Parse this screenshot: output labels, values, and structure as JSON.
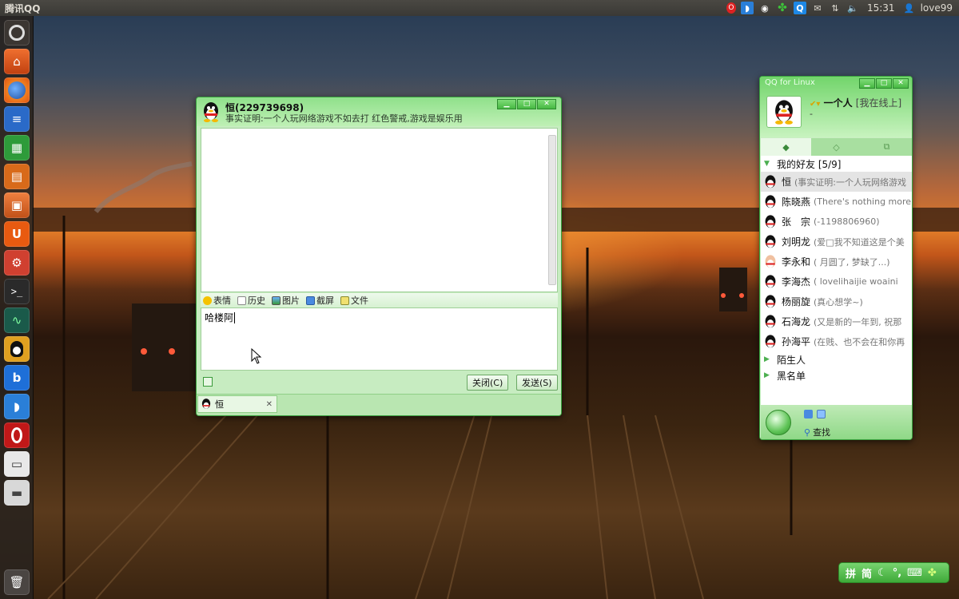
{
  "top_panel": {
    "app_title": "腾讯QQ",
    "clock": "15:31",
    "user": "love99",
    "tray_icons": [
      "opera-icon",
      "rss-icon",
      "qq-icon",
      "clover-icon",
      "qq-browser-icon",
      "mail-icon",
      "network-icon",
      "volume-icon",
      "user-icon"
    ]
  },
  "launcher": {
    "items": [
      "dash-home",
      "home-folder",
      "firefox",
      "writer",
      "calc",
      "impress",
      "software-center",
      "ubuntu-one",
      "system-settings",
      "terminal",
      "system-monitor",
      "qq",
      "baidu",
      "rss-reader",
      "opera",
      "window-app",
      "disk-drive",
      "trash"
    ]
  },
  "chat_window": {
    "contact_name": "恒(229739698)",
    "signature": "事实证明:一个人玩网络游戏不如去打 红色警戒,游戏是娱乐用",
    "toolbar": {
      "emoticon": "表情",
      "history": "历史",
      "image": "图片",
      "screenshot": "截屏",
      "file": "文件"
    },
    "input_text": "哈楼阿",
    "close_button": "关闭(C)",
    "send_button": "发送(S)",
    "tab_label": "恒"
  },
  "qq_panel": {
    "title": "QQ for Linux",
    "self_name": "一个人",
    "self_status": "[我在线上]",
    "self_sub": "-",
    "groups": {
      "friends_label": "我的好友 [5/9]",
      "strangers_label": "陌生人",
      "blacklist_label": "黑名单"
    },
    "friends": [
      {
        "name": "恒",
        "signature": "(事实证明:一个人玩网络游戏",
        "selected": true
      },
      {
        "name": "陈晓燕",
        "signature": "(There's nothing more"
      },
      {
        "name": "张　宗",
        "signature": "(-1198806960)"
      },
      {
        "name": "刘明龙",
        "signature": "(爱□我不知道这是个美"
      },
      {
        "name": "李永和",
        "signature": "( 月圆了, 梦缺了...)"
      },
      {
        "name": "李海杰",
        "signature": "( lovelihaijie      woaini"
      },
      {
        "name": "杨丽旋",
        "signature": "(真心想学~)"
      },
      {
        "name": "石海龙",
        "signature": "(又是新的一年到, 祝那"
      },
      {
        "name": "孙海平",
        "signature": "(在贱、也不会在和你再"
      }
    ],
    "find_label": "查找"
  },
  "ime_bar": {
    "pinyin": "拼",
    "simplified": "简"
  },
  "colors": {
    "qq_green": "#47b943",
    "panel_bg": "#3a3935",
    "launcher_bg": "#28221e"
  }
}
